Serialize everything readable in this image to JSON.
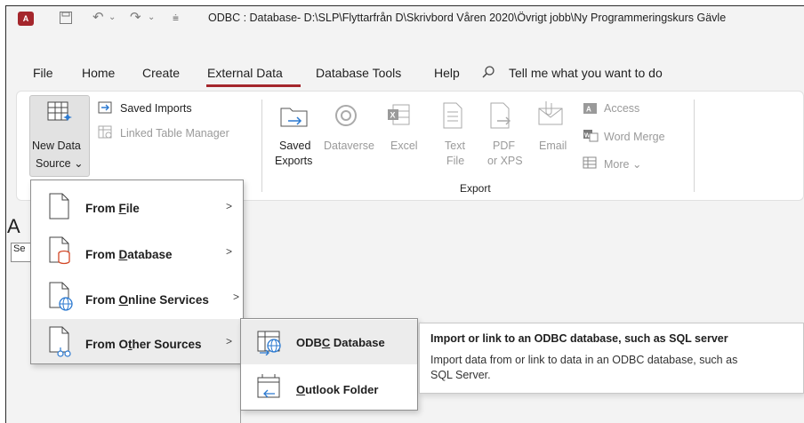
{
  "window": {
    "title": "ODBC : Database- D:\\SLP\\Flyttarfrån D\\Skrivbord Våren 2020\\Övrigt jobb\\Ny Programmeringskurs Gävle",
    "app_logo": "A"
  },
  "menu": {
    "tabs": [
      "File",
      "Home",
      "Create",
      "External Data",
      "Database Tools",
      "Help"
    ],
    "active_tab": "External Data",
    "search_placeholder": "Tell me what you want to do"
  },
  "ribbon": {
    "import_group": {
      "new_data_source_line1": "New Data",
      "new_data_source_line2": "Source",
      "saved_imports": "Saved Imports",
      "linked_table_manager": "Linked Table Manager"
    },
    "export_group": {
      "label": "Export",
      "saved_exports_line1": "Saved",
      "saved_exports_line2": "Exports",
      "dataverse": "Dataverse",
      "excel": "Excel",
      "text_file_line1": "Text",
      "text_file_line2": "File",
      "pdf_line1": "PDF",
      "pdf_line2": "or XPS",
      "email": "Email",
      "access": "Access",
      "word_merge": "Word Merge",
      "more": "More"
    }
  },
  "background": {
    "letter": "A",
    "input_value": "Se"
  },
  "dropdown": {
    "items": [
      {
        "label_pre": "From ",
        "label_key": "F",
        "label_post": "ile"
      },
      {
        "label_pre": "From ",
        "label_key": "D",
        "label_post": "atabase"
      },
      {
        "label_pre": "From ",
        "label_key": "O",
        "label_post": "nline Services"
      },
      {
        "label_pre": "From O",
        "label_key": "t",
        "label_post": "her Sources"
      }
    ]
  },
  "submenu": {
    "items": [
      {
        "label_pre": "ODB",
        "label_key": "C",
        "label_post": " Database"
      },
      {
        "label_pre": "",
        "label_key": "O",
        "label_post": "utlook Folder"
      }
    ]
  },
  "tooltip": {
    "title": "Import or link to an ODBC database, such as SQL server",
    "body": "Import data from or link to data in an ODBC database, such as SQL Server."
  },
  "colors": {
    "accent": "#a4262c",
    "link_blue": "#2b79d0",
    "dim": "#9a9a9a"
  }
}
